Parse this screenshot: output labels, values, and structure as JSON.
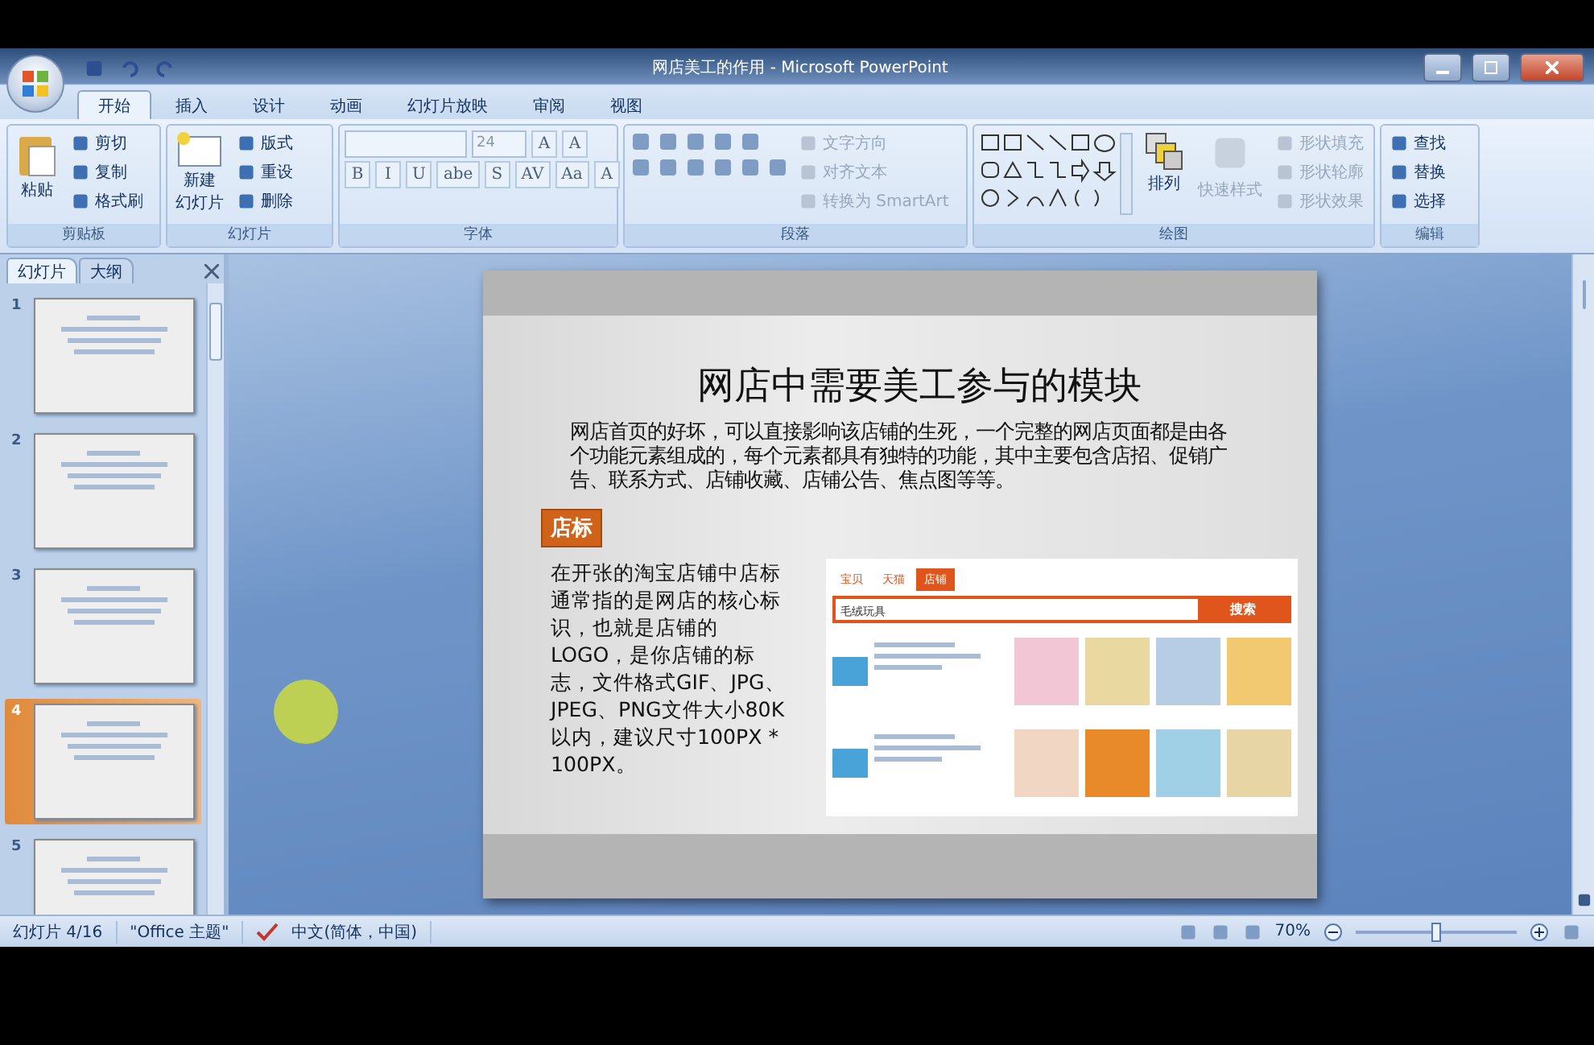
{
  "window": {
    "title": "网店美工的作用 - Microsoft PowerPoint"
  },
  "ribbon_tabs": [
    {
      "label": "开始",
      "selected": true
    },
    {
      "label": "插入",
      "selected": false
    },
    {
      "label": "设计",
      "selected": false
    },
    {
      "label": "动画",
      "selected": false
    },
    {
      "label": "幻灯片放映",
      "selected": false
    },
    {
      "label": "审阅",
      "selected": false
    },
    {
      "label": "视图",
      "selected": false
    }
  ],
  "ribbon_groups": [
    {
      "kind": "clipboard",
      "label": "剪贴板",
      "large": [
        "粘贴"
      ],
      "items": [
        {
          "label": "剪切",
          "disabled": false
        },
        {
          "label": "复制",
          "disabled": false
        },
        {
          "label": "格式刷",
          "disabled": false
        }
      ]
    },
    {
      "kind": "slides",
      "label": "幻灯片",
      "large": [
        "新建",
        "幻灯片"
      ],
      "items": [
        {
          "label": "版式",
          "disabled": false
        },
        {
          "label": "重设",
          "disabled": false
        },
        {
          "label": "删除",
          "disabled": false
        }
      ]
    },
    {
      "kind": "font",
      "label": "字体",
      "font_size": "24",
      "size_buttons": [
        "A",
        "A"
      ],
      "format_buttons": [
        "B",
        "I",
        "U",
        "abe",
        "S",
        "AV",
        "Aa",
        "A"
      ]
    },
    {
      "kind": "paragraph",
      "label": "段落",
      "items": [
        {
          "label": "文字方向",
          "disabled": true
        },
        {
          "label": "对齐文本",
          "disabled": true
        },
        {
          "label": "转换为 SmartArt",
          "disabled": true
        }
      ]
    },
    {
      "kind": "drawing",
      "label": "绘图",
      "large": [
        "排列"
      ],
      "quick_styles": {
        "label": "快速样式",
        "disabled": true
      },
      "items": [
        {
          "label": "形状填充",
          "disabled": true
        },
        {
          "label": "形状轮廓",
          "disabled": true
        },
        {
          "label": "形状效果",
          "disabled": true
        }
      ]
    },
    {
      "kind": "editing",
      "label": "编辑",
      "items": [
        {
          "label": "查找",
          "disabled": false
        },
        {
          "label": "替换",
          "disabled": false
        },
        {
          "label": "选择",
          "disabled": false
        }
      ]
    }
  ],
  "pane_tabs": [
    {
      "label": "幻灯片",
      "selected": true
    },
    {
      "label": "大纲",
      "selected": false
    }
  ],
  "thumbnails": [
    {
      "number": "1",
      "selected": false
    },
    {
      "number": "2",
      "selected": false
    },
    {
      "number": "3",
      "selected": false
    },
    {
      "number": "4",
      "selected": true
    },
    {
      "number": "5",
      "selected": false
    }
  ],
  "slide": {
    "title": "网店中需要美工参与的模块",
    "paragraph": "网店首页的好坏，可以直接影响该店铺的生死，一个完整的网店页面都是由各个功能元素组成的，每个元素都具有独特的功能，其中主要包含店招、促销广告、联系方式、店铺收藏、店铺公告、焦点图等等。",
    "section_label": "店标",
    "body": "在开张的淘宝店铺中店标通常指的是网店的核心标识，也就是店铺的LOGO，是你店铺的标志，文件格式GIF、JPG、JPEG、PNG文件大小80K以内，建议尺寸100PX * 100PX。",
    "embedded": {
      "tabs": [
        {
          "label": "宝贝",
          "selected": false
        },
        {
          "label": "天猫",
          "selected": false
        },
        {
          "label": "店铺",
          "selected": true
        }
      ],
      "search_value": "毛绒玩具",
      "search_button": "搜索"
    }
  },
  "status_bar": {
    "slide_info": "幻灯片 4/16",
    "theme": "\"Office 主题\"",
    "language": "中文(简体，中国)",
    "zoom": "70%",
    "zoom_slider": {
      "level": 0.5
    }
  }
}
